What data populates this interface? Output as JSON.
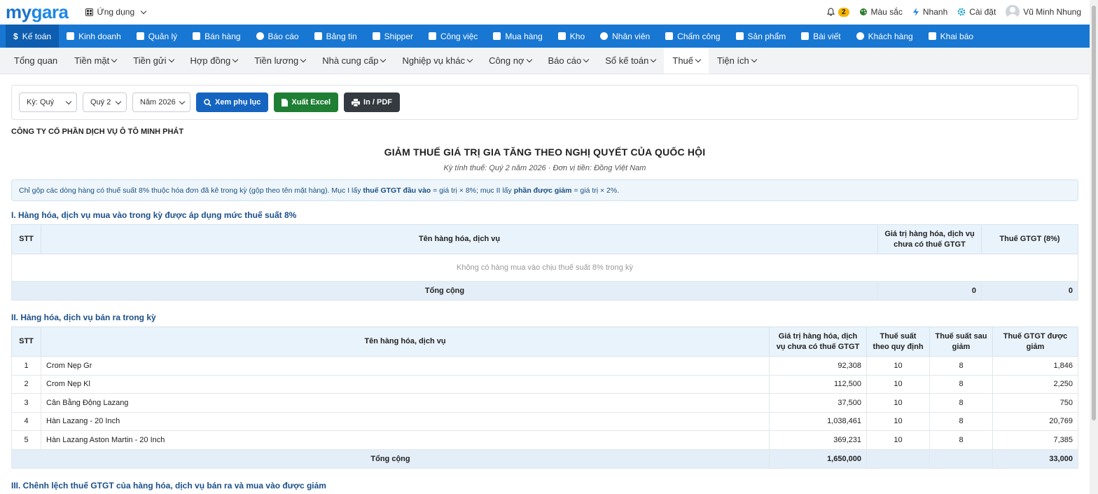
{
  "brand": {
    "logo_my": "my",
    "logo_gara": "gara"
  },
  "topbar": {
    "app_switch": "Ứng dụng",
    "notif_count": "2",
    "colors": "Màu sắc",
    "quick": "Nhanh",
    "settings": "Cài đặt",
    "user": "Vũ Minh Nhung"
  },
  "mainnav": [
    {
      "label": "Kế toán",
      "icon": "dollar-icon"
    },
    {
      "label": "Kinh doanh",
      "icon": "bag-icon"
    },
    {
      "label": "Quản lý",
      "icon": "id-card-icon"
    },
    {
      "label": "Bán hàng",
      "icon": "cart-icon"
    },
    {
      "label": "Báo cáo",
      "icon": "pie-chart-icon"
    },
    {
      "label": "Bảng tin",
      "icon": "home-icon"
    },
    {
      "label": "Shipper",
      "icon": "truck-icon"
    },
    {
      "label": "Công việc",
      "icon": "calendar-icon"
    },
    {
      "label": "Mua hàng",
      "icon": "basket-icon"
    },
    {
      "label": "Kho",
      "icon": "warehouse-icon"
    },
    {
      "label": "Nhân viên",
      "icon": "user-icon"
    },
    {
      "label": "Chấm công",
      "icon": "calendar-check-icon"
    },
    {
      "label": "Sản phẩm",
      "icon": "box-icon"
    },
    {
      "label": "Bài viết",
      "icon": "book-icon"
    },
    {
      "label": "Khách hàng",
      "icon": "smile-icon"
    },
    {
      "label": "Khai báo",
      "icon": "list-icon"
    }
  ],
  "subnav": [
    {
      "label": "Tổng quan",
      "dropdown": false
    },
    {
      "label": "Tiền mặt",
      "dropdown": true
    },
    {
      "label": "Tiền gửi",
      "dropdown": true
    },
    {
      "label": "Hợp đồng",
      "dropdown": true
    },
    {
      "label": "Tiền lương",
      "dropdown": true
    },
    {
      "label": "Nhà cung cấp",
      "dropdown": true
    },
    {
      "label": "Nghiệp vụ khác",
      "dropdown": true
    },
    {
      "label": "Công nợ",
      "dropdown": true
    },
    {
      "label": "Báo cáo",
      "dropdown": true
    },
    {
      "label": "Sổ kế toán",
      "dropdown": true
    },
    {
      "label": "Thuế",
      "dropdown": true
    },
    {
      "label": "Tiện ích",
      "dropdown": true
    }
  ],
  "filters": {
    "period": "Kỳ: Quý",
    "quarter": "Quý 2",
    "year": "Năm 2026",
    "view_btn": "Xem phụ lục",
    "excel_btn": "Xuất Excel",
    "print_btn": "In / PDF"
  },
  "report": {
    "company": "CÔNG TY CỔ PHẦN DỊCH VỤ Ô TÔ MINH PHÁT",
    "title": "GIẢM THUẾ GIÁ TRỊ GIA TĂNG THEO NGHỊ QUYẾT CỦA QUỐC HỘI",
    "subtitle": "Kỳ tính thuế: Quý 2 năm 2026  ·  Đơn vị tiền: Đồng Việt Nam",
    "note_1": "Chỉ gộp các dòng hàng có thuế suất 8% thuộc hóa đơn đã kê trong kỳ (gộp theo tên mặt hàng). Mục I lấy ",
    "note_b1": "thuế GTGT đầu vào",
    "note_2": " = giá trị × 8%; mục II lấy ",
    "note_b2": "phần được giảm",
    "note_3": " = giá trị × 2%."
  },
  "section1": {
    "title": "I. Hàng hóa, dịch vụ mua vào trong kỳ được áp dụng mức thuế suất 8%",
    "headers": [
      "STT",
      "Tên hàng hóa, dịch vụ",
      "Giá trị hàng hóa, dịch vụ chưa có thuế GTGT",
      "Thuế GTGT (8%)"
    ],
    "empty": "Không có hàng mua vào chịu thuế suất 8% trong kỳ",
    "total_label": "Tổng cộng",
    "total_value": "0",
    "total_tax": "0"
  },
  "section2": {
    "title": "II. Hàng hóa, dịch vụ bán ra trong kỳ",
    "headers": [
      "STT",
      "Tên hàng hóa, dịch vụ",
      "Giá trị hàng hóa, dịch vụ chưa có thuế GTGT",
      "Thuế suất theo quy định",
      "Thuế suất sau giảm",
      "Thuế GTGT được giảm"
    ],
    "rows": [
      {
        "stt": "1",
        "name": "Crom Nẹp Gr",
        "value": "92,308",
        "rate": "10",
        "new_rate": "8",
        "reduced": "1,846"
      },
      {
        "stt": "2",
        "name": "Crom Nẹp Kl",
        "value": "112,500",
        "rate": "10",
        "new_rate": "8",
        "reduced": "2,250"
      },
      {
        "stt": "3",
        "name": "Cân Bằng Động Lazang",
        "value": "37,500",
        "rate": "10",
        "new_rate": "8",
        "reduced": "750"
      },
      {
        "stt": "4",
        "name": "Hàn Lazang - 20 Inch",
        "value": "1,038,461",
        "rate": "10",
        "new_rate": "8",
        "reduced": "20,769"
      },
      {
        "stt": "5",
        "name": "Hàn Lazang Aston Martin - 20 Inch",
        "value": "369,231",
        "rate": "10",
        "new_rate": "8",
        "reduced": "7,385"
      }
    ],
    "total_label": "Tổng cộng",
    "total_value": "1,650,000",
    "total_reduced": "33,000"
  },
  "section3": {
    "title": "III. Chênh lệch thuế GTGT của hàng hóa, dịch vụ bán ra và mua vào được giảm"
  }
}
